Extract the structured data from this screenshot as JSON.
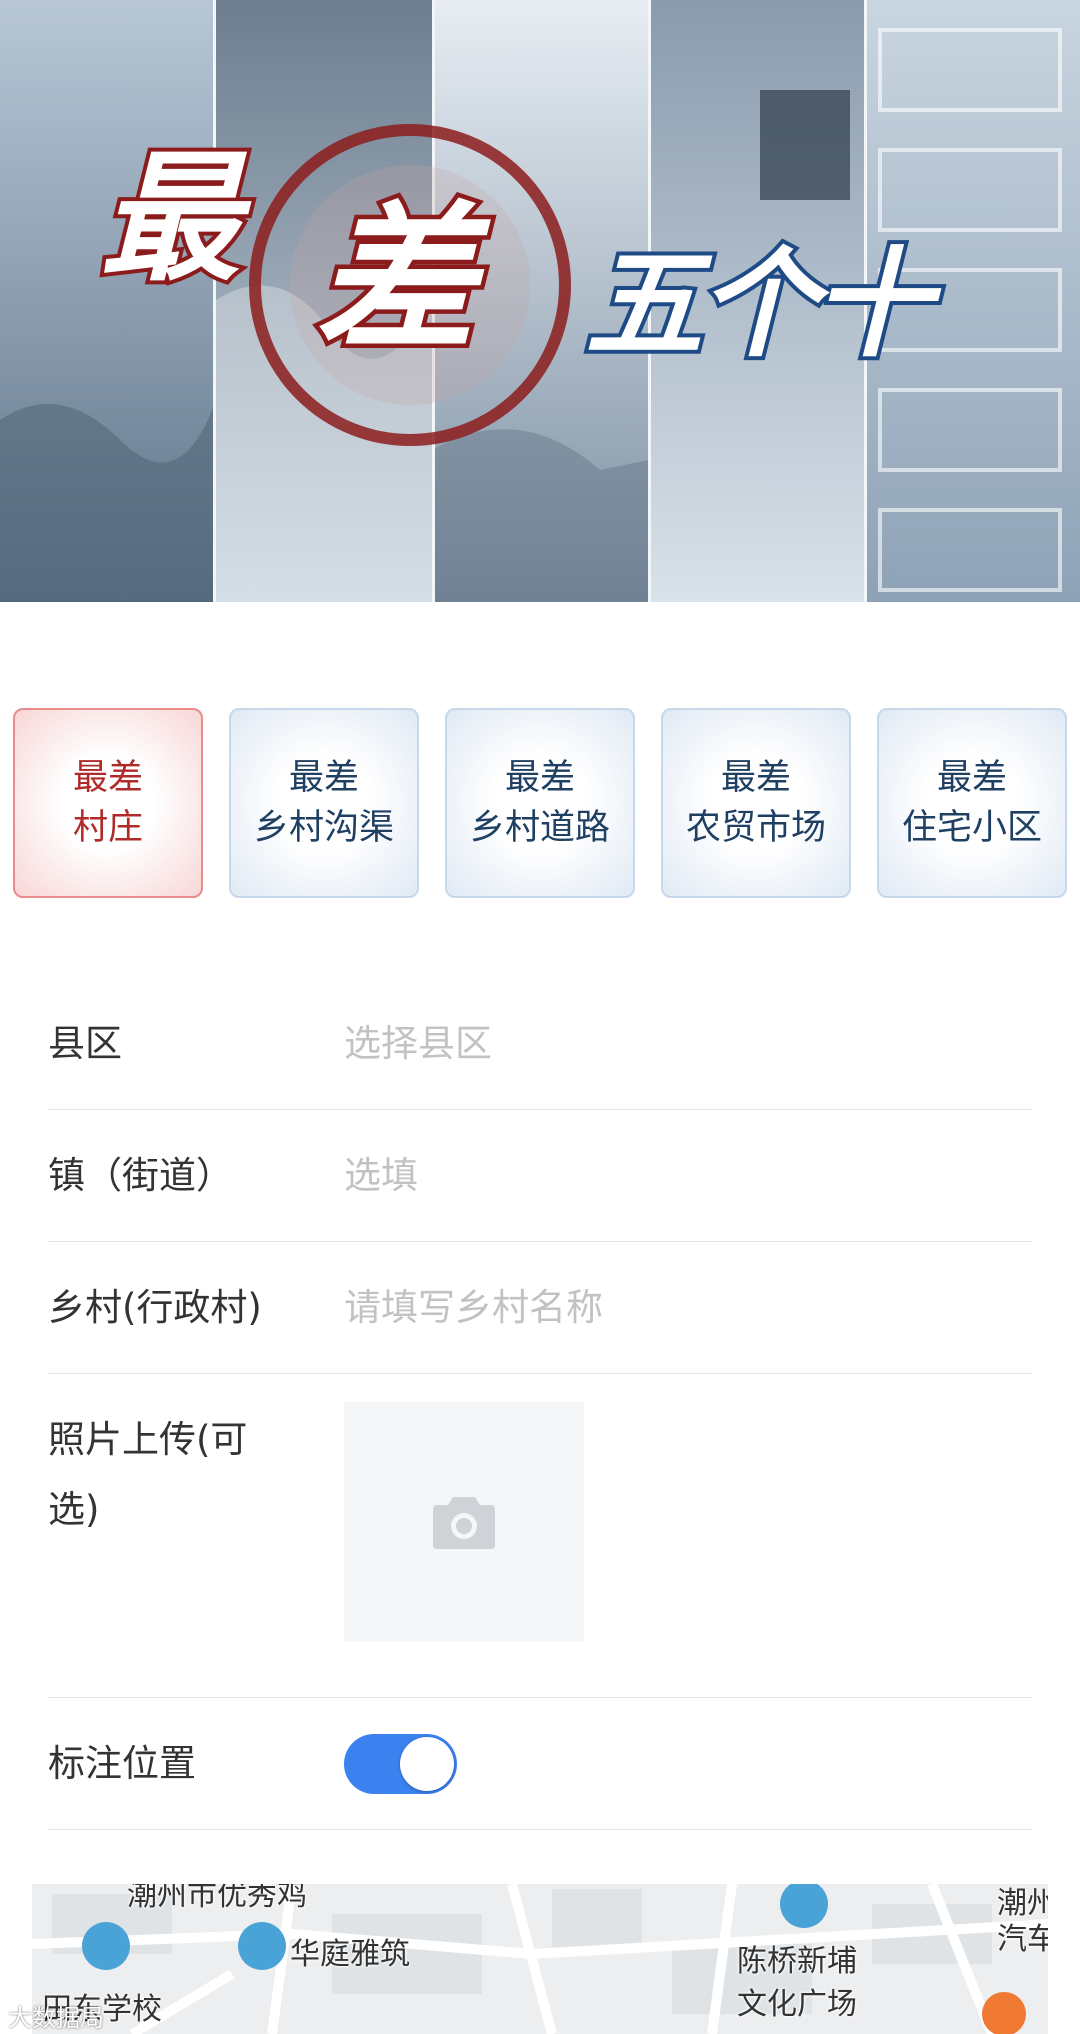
{
  "banner": {
    "title_char_1": "最",
    "title_char_2": "差",
    "title_rest": "五个十"
  },
  "tabs": [
    {
      "line1": "最差",
      "line2": "村庄",
      "active": true
    },
    {
      "line1": "最差",
      "line2": "乡村沟渠",
      "active": false
    },
    {
      "line1": "最差",
      "line2": "乡村道路",
      "active": false
    },
    {
      "line1": "最差",
      "line2": "农贸市场",
      "active": false
    },
    {
      "line1": "最差",
      "line2": "住宅小区",
      "active": false
    }
  ],
  "form": {
    "county": {
      "label": "县区",
      "placeholder": "选择县区"
    },
    "town": {
      "label": "镇（街道）",
      "placeholder": "选填"
    },
    "village": {
      "label": "乡村(行政村)",
      "placeholder": "请填写乡村名称"
    },
    "photo": {
      "label_line1": "照片上传(可",
      "label_line2": "选)",
      "icon": "camera-icon"
    },
    "location": {
      "label": "标注位置",
      "toggle_on": true
    }
  },
  "map": {
    "labels": [
      "潮州市优秀鸡",
      "华庭雅筑",
      "田东学校",
      "陈桥新埔",
      "文化广场",
      "潮州",
      "汽车"
    ]
  },
  "watermark": "大数据局",
  "colors": {
    "accent": "#3b82f0",
    "active_tab_text": "#b12a2a",
    "tab_text": "#1f4063",
    "banner_red": "#8c1c1c",
    "banner_blue": "#1e4a86"
  }
}
